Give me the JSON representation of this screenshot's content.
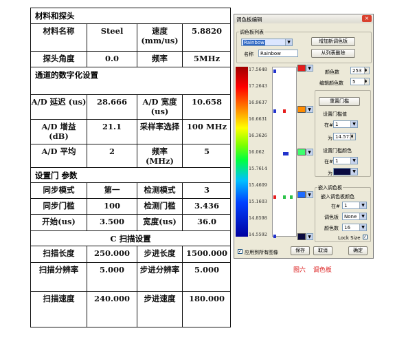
{
  "table": {
    "sec_material": "材料和探头",
    "r1": {
      "c1": "材料名称",
      "c2": "Steel",
      "c3": "速度 (mm/us)",
      "c4": "5.8820"
    },
    "r2": {
      "c1": "探头角度",
      "c2": "0.0",
      "c3": "频率",
      "c4": "5MHz"
    },
    "sec_digital": "通道的数字化设置",
    "r3": {
      "c1": "A/D 延迟 (us)",
      "c2": "28.666",
      "c3": "A/D 宽度 (us)",
      "c4": "10.658"
    },
    "r4": {
      "c1": "A/D 增益 (dB)",
      "c2": "21.1",
      "c3": "采样率选择",
      "c4": "100 MHz"
    },
    "r5": {
      "c1": "A/D 平均",
      "c2": "2",
      "c3": "频率 (MHz)",
      "c4": "5"
    },
    "sec_gate": "设置门 参数",
    "r6": {
      "c1": "同步模式",
      "c2": "第一",
      "c3": "检测模式",
      "c4": "3"
    },
    "r7": {
      "c1": "同步门槛",
      "c2": "100",
      "c3": "检测门槛",
      "c4": "3.436"
    },
    "r8": {
      "c1": "开始(us)",
      "c2": "3.500",
      "c3": "宽度(us)",
      "c4": "36.0"
    },
    "sec_cscan": "C 扫描设置",
    "r9": {
      "c1": "扫描长度",
      "c2": "250.000",
      "c3": "步进长度",
      "c4": "1500.000"
    },
    "r10": {
      "c1": "扫描分辨率",
      "c2": "5.000",
      "c3": "步进分辨率",
      "c4": "5.000"
    },
    "r11": {
      "c1": "扫描速度",
      "c2": "240.000",
      "c3": "步进速度",
      "c4": "180.000"
    }
  },
  "editor": {
    "title": "调色板编辑",
    "close": "×",
    "list_group": "调色板列表",
    "palette_select": "Rainbow",
    "add_btn": "增加新调色板",
    "from_file_btn": "从列表删除",
    "name_label": "名称",
    "name_value": "Rainbow",
    "ticks": [
      "17.5648",
      "17.2643",
      "16.9637",
      "16.6631",
      "16.3626",
      "16.062",
      "15.7614",
      "15.4609",
      "15.1603",
      "14.8598",
      "14.5592"
    ],
    "color_count_label": "颜色数",
    "color_count": "253",
    "edit_color_label": "编辑颜色数",
    "edit_color": "5",
    "reset_gate_btn": "重置门槛",
    "set_gate_value_label": "设置门槛值",
    "at_label": "在#",
    "at_value": "1",
    "is_label": "为",
    "is_value": "14.571",
    "set_gate_color_label": "设置门槛颜色",
    "at2_value": "1",
    "embed_group": "嵌入调色板",
    "embed_color_label": "嵌入调色板颜色",
    "at3_value": "1",
    "palette_label": "调色板",
    "palette_value": "None",
    "colors_label": "颜色数",
    "colors_value": "16",
    "lock_size": "Lock Size",
    "apply_all": "应用到所有图像",
    "save_btn": "保存",
    "cancel_btn": "取消",
    "ok_btn": "确定",
    "colors": {
      "red": "#e51c1c",
      "orange": "#ff8c00",
      "green": "#3dff6e",
      "blue": "#1d6bff",
      "navy": "#0a0a40"
    }
  },
  "caption": "图六 调色板"
}
